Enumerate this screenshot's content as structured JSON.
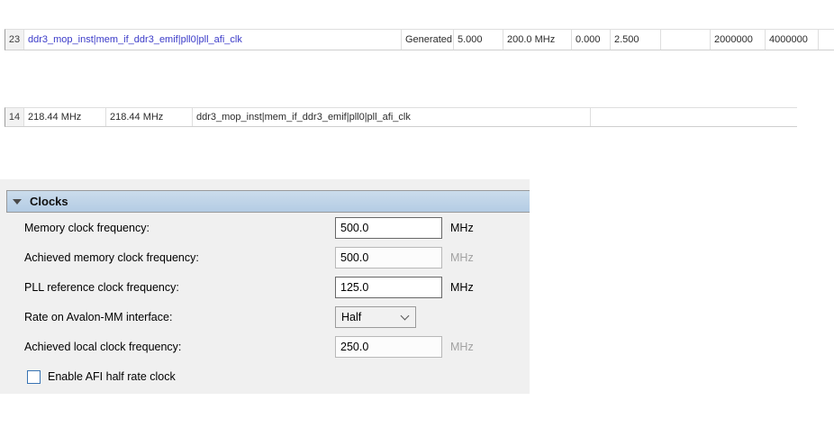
{
  "colors": {
    "link_blue": "#3a3ac8",
    "panel_bg": "#f0f0f0",
    "header_blue": "#bacfe5",
    "checkbox_border": "#3873b3"
  },
  "tables": {
    "generated_clocks": {
      "cells": [
        "23",
        "ddr3_mop_inst|mem_if_ddr3_emif|pll0|pll_afi_clk",
        "Generated",
        "5.000",
        "200.0 MHz",
        "0.000",
        "2.500",
        "",
        "2000000",
        "4000000",
        ""
      ]
    },
    "fmax_summary": {
      "cells": [
        "14",
        "218.44 MHz",
        "218.44 MHz",
        "ddr3_mop_inst|mem_if_ddr3_emif|pll0|pll_afi_clk",
        ""
      ]
    }
  },
  "clocks_panel": {
    "title": "Clocks",
    "fields": [
      {
        "label": "Memory clock frequency:",
        "value": "500.0",
        "unit": "MHz",
        "editable": true
      },
      {
        "label": "Achieved memory clock frequency:",
        "value": "500.0",
        "unit": "MHz",
        "editable": false
      },
      {
        "label": "PLL reference clock frequency:",
        "value": "125.0",
        "unit": "MHz",
        "editable": true
      },
      {
        "label": "Rate on Avalon-MM interface:",
        "value": "Half",
        "unit": "",
        "editable": true
      },
      {
        "label": "Achieved local clock frequency:",
        "value": "250.0",
        "unit": "MHz",
        "editable": false
      }
    ],
    "checkbox": {
      "label": "Enable AFI half rate clock",
      "checked": false
    }
  }
}
